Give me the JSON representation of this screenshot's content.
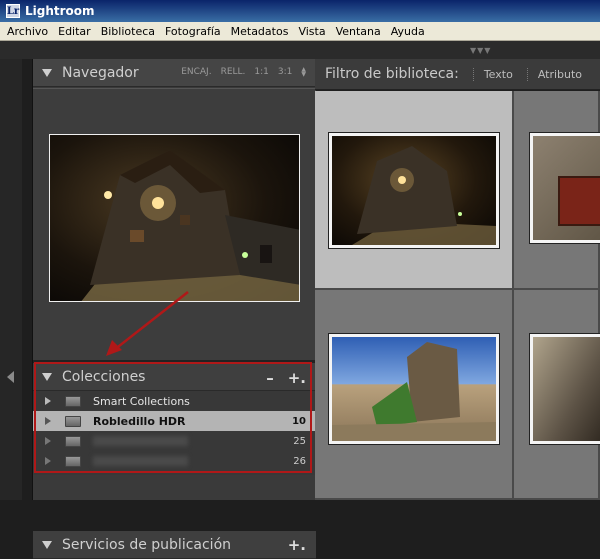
{
  "app": {
    "title": "Lightroom",
    "logo_glyph": "Lr"
  },
  "menu": [
    "Archivo",
    "Editar",
    "Biblioteca",
    "Fotografía",
    "Metadatos",
    "Vista",
    "Ventana",
    "Ayuda"
  ],
  "navigator": {
    "title": "Navegador",
    "options": [
      "ENCAJ.",
      "RELL.",
      "1:1",
      "3:1"
    ]
  },
  "collections": {
    "title": "Colecciones",
    "minus": "–",
    "plus": "+.",
    "items": [
      {
        "label": "Smart Collections",
        "count": ""
      },
      {
        "label": "Robledillo HDR",
        "count": "10"
      },
      {
        "label": "",
        "count": "25"
      },
      {
        "label": "",
        "count": "26"
      }
    ]
  },
  "publish": {
    "title": "Servicios de publicación",
    "plus": "+."
  },
  "filter": {
    "label": "Filtro de biblioteca:",
    "options": [
      "Texto",
      "Atributo"
    ]
  },
  "colors": {
    "annotation_red": "#b01818",
    "selected_row": "#b4b4b4"
  }
}
